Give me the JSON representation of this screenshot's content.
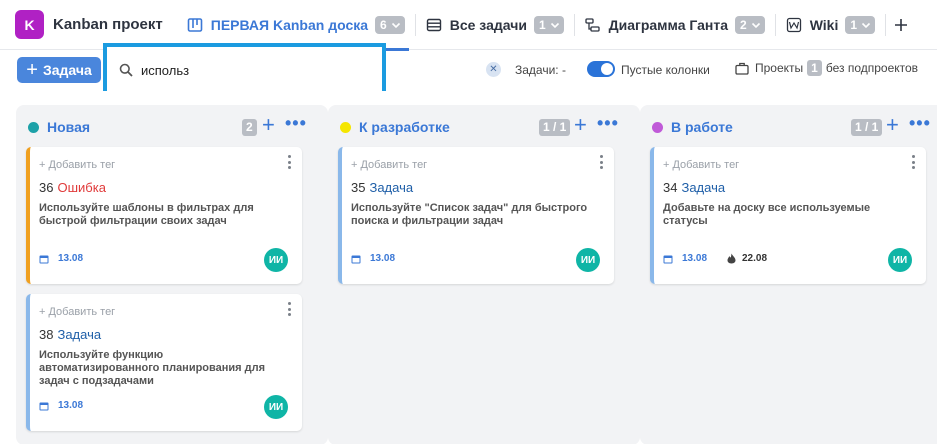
{
  "project": {
    "logo_letter": "K",
    "name": "Kanban проект"
  },
  "tabs": [
    {
      "label": "ПЕРВАЯ Kanban доска",
      "count": "6",
      "active": true
    },
    {
      "label": "Все задачи",
      "count": "1"
    },
    {
      "label": "Диаграмма Ганта",
      "count": "2"
    },
    {
      "label": "Wiki",
      "count": "1"
    }
  ],
  "toolbar": {
    "add_label": "Задача",
    "search_value": "использ",
    "tasks_label": "Задачи: -",
    "empty_columns_label": "Пустые колонки",
    "projects_label": "Проекты",
    "projects_count": "1",
    "subprojects_label": "без подпроектов"
  },
  "columns": [
    {
      "title": "Новая",
      "count": "2",
      "color": "#1da1a8",
      "cards": [
        {
          "tag": "+ Добавить тег",
          "num": "36",
          "type": "Ошибка",
          "is_bug": true,
          "accent": "#f0a020",
          "desc": "Используйте шаблоны в фильтрах для быстрой фильтрации своих задач",
          "date": "13.08",
          "avatar": "ИИ"
        },
        {
          "tag": "+ Добавить тег",
          "num": "38",
          "type": "Задача",
          "accent": "#8ab8ea",
          "desc": "Используйте функцию автоматизированного планирования для задач с подзадачами",
          "date": "13.08",
          "avatar": "ИИ"
        }
      ]
    },
    {
      "title": "К разработке",
      "count": "1 / 1",
      "color": "#f5e600",
      "cards": [
        {
          "tag": "+ Добавить тег",
          "num": "35",
          "type": "Задача",
          "accent": "#8ab8ea",
          "desc": "Используйте \"Список задач\" для быстрого поиска и фильтрации задач",
          "date": "13.08",
          "avatar": "ИИ"
        }
      ]
    },
    {
      "title": "В работе",
      "count": "1 / 1",
      "color": "#c05ad8",
      "cards": [
        {
          "tag": "+ Добавить тег",
          "num": "34",
          "type": "Задача",
          "accent": "#8ab8ea",
          "desc": "Добавьте на доску все используемые статусы",
          "date": "13.08",
          "due": "22.08",
          "avatar": "ИИ"
        }
      ]
    }
  ]
}
